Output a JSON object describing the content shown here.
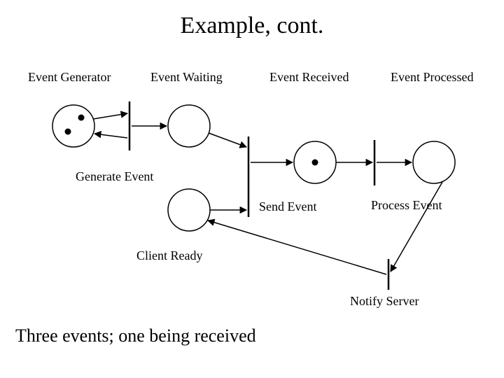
{
  "title": "Example, cont.",
  "labels": {
    "eventGenerator": "Event Generator",
    "eventWaiting": "Event Waiting",
    "eventReceived": "Event Received",
    "eventProcessed": "Event Processed",
    "generateEvent": "Generate Event",
    "sendEvent": "Send Event",
    "processEvent": "Process Event",
    "clientReady": "Client Ready",
    "notifyServer": "Notify Server"
  },
  "caption": "Three events; one being received",
  "diagram": {
    "type": "petri-net",
    "places": [
      {
        "name": "Event Generator",
        "tokens": 2
      },
      {
        "name": "Event Waiting",
        "tokens": 0
      },
      {
        "name": "Event Received",
        "tokens": 1
      },
      {
        "name": "Event Processed",
        "tokens": 0
      },
      {
        "name": "Client Ready",
        "tokens": 0
      }
    ],
    "transitions": [
      "Generate Event",
      "Send Event",
      "Process Event",
      "Notify Server"
    ],
    "arcs": [
      [
        "Event Generator",
        "Generate Event"
      ],
      [
        "Generate Event",
        "Event Generator"
      ],
      [
        "Generate Event",
        "Event Waiting"
      ],
      [
        "Event Waiting",
        "Send Event"
      ],
      [
        "Send Event",
        "Event Received"
      ],
      [
        "Client Ready",
        "Send Event"
      ],
      [
        "Event Received",
        "Process Event"
      ],
      [
        "Process Event",
        "Event Processed"
      ],
      [
        "Event Processed",
        "Notify Server"
      ],
      [
        "Notify Server",
        "Client Ready"
      ]
    ]
  }
}
